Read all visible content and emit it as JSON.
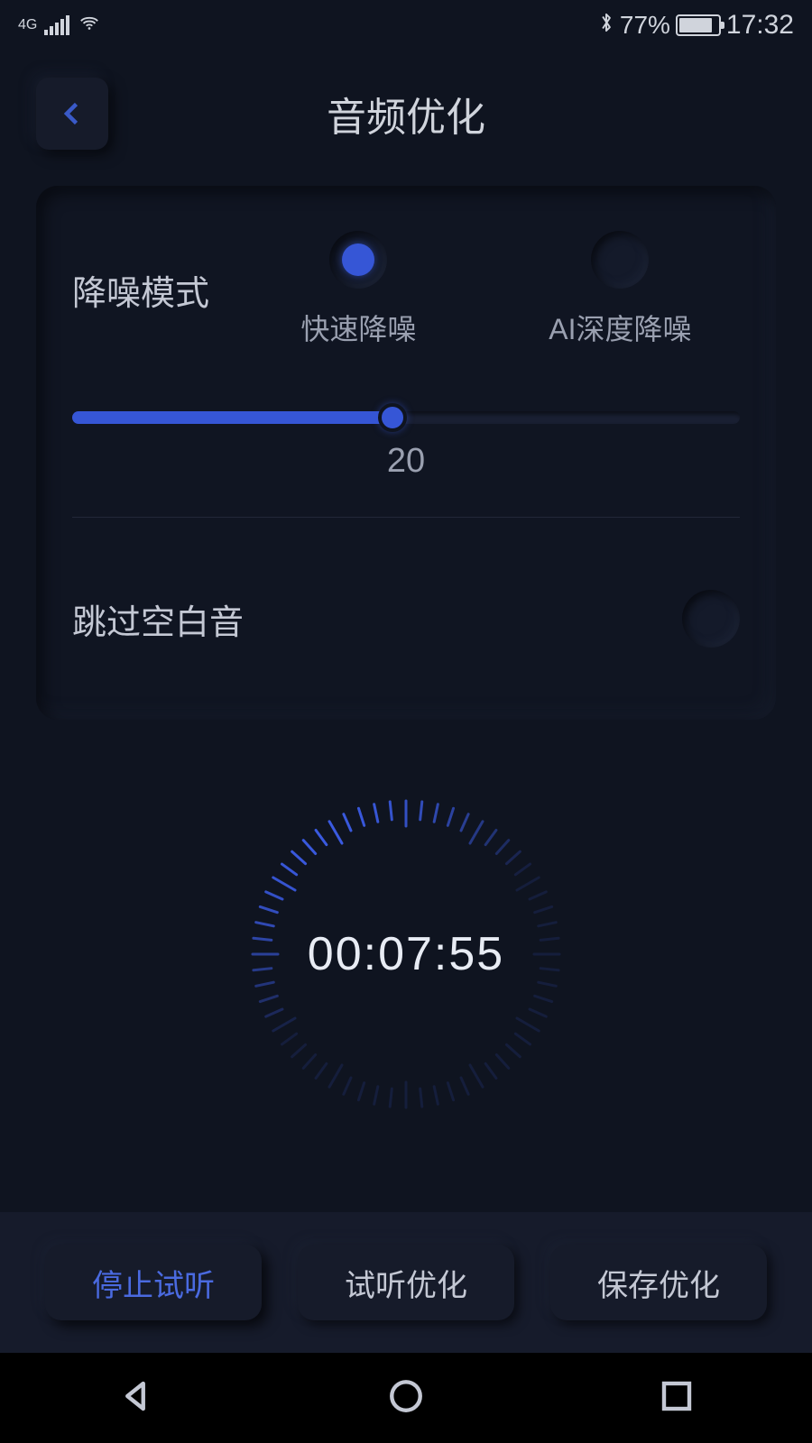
{
  "statusbar": {
    "network": "4G",
    "battery_pct": "77%",
    "time": "17:32"
  },
  "header": {
    "title": "音频优化"
  },
  "card": {
    "noise_label": "降噪模式",
    "radio1_label": "快速降噪",
    "radio2_label": "AI深度降噪",
    "slider_value": "20",
    "skip_label": "跳过空白音"
  },
  "timer": {
    "display": "00:07:55"
  },
  "actions": {
    "stop_preview": "停止试听",
    "preview_optimize": "试听优化",
    "save_optimize": "保存优化"
  }
}
